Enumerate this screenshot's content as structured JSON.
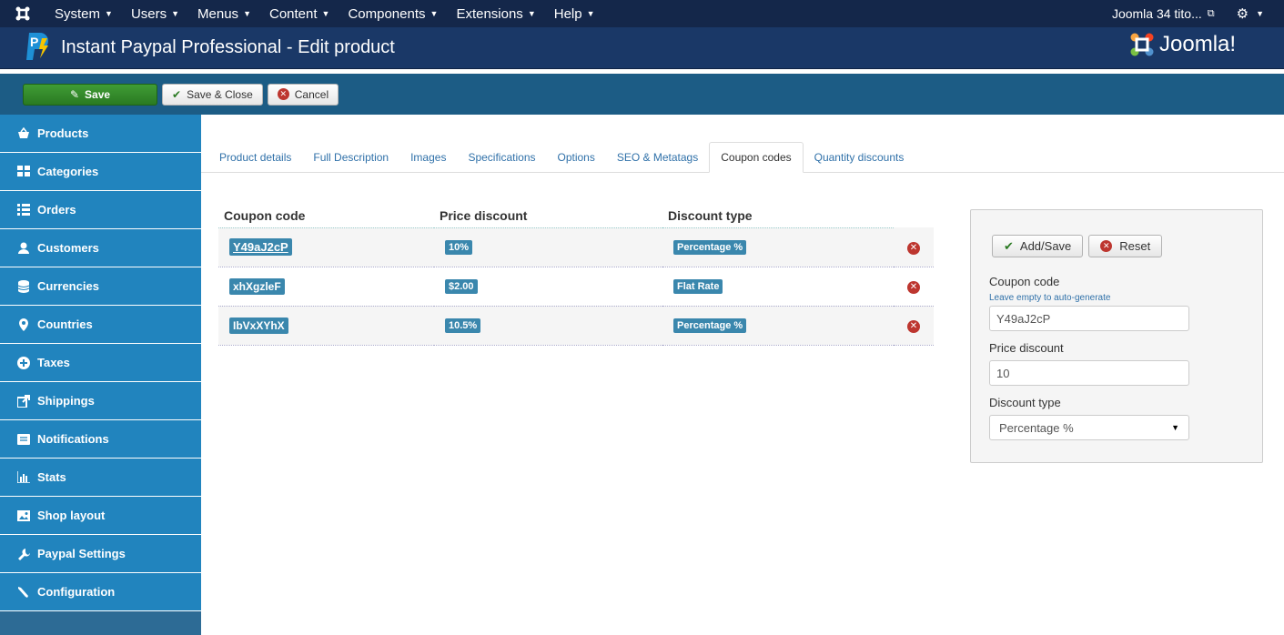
{
  "menubar": {
    "items": [
      "System",
      "Users",
      "Menus",
      "Content",
      "Components",
      "Extensions",
      "Help"
    ],
    "site_link": "Joomla 34 tito...",
    "icons": {
      "logo": "joomla-logo-icon",
      "external": "external-link-icon",
      "settings": "gear-icon"
    }
  },
  "header": {
    "title": "Instant Paypal Professional - Edit product",
    "brand": "Joomla!",
    "app_icon": "paypal-pro-icon"
  },
  "toolbar": {
    "save_label": "Save",
    "save_close_label": "Save & Close",
    "cancel_label": "Cancel"
  },
  "sidebar": {
    "items": [
      {
        "label": "Products",
        "icon": "basket-icon"
      },
      {
        "label": "Categories",
        "icon": "grid-icon"
      },
      {
        "label": "Orders",
        "icon": "list-icon"
      },
      {
        "label": "Customers",
        "icon": "user-icon"
      },
      {
        "label": "Currencies",
        "icon": "database-icon"
      },
      {
        "label": "Countries",
        "icon": "location-pin-icon"
      },
      {
        "label": "Taxes",
        "icon": "plus-circle-icon"
      },
      {
        "label": "Shippings",
        "icon": "share-icon"
      },
      {
        "label": "Notifications",
        "icon": "message-icon"
      },
      {
        "label": "Stats",
        "icon": "bar-chart-icon"
      },
      {
        "label": "Shop layout",
        "icon": "image-icon"
      },
      {
        "label": "Paypal Settings",
        "icon": "wrench-icon"
      },
      {
        "label": "Configuration",
        "icon": "tool-icon"
      }
    ]
  },
  "tabs": {
    "items": [
      "Product details",
      "Full Description",
      "Images",
      "Specifications",
      "Options",
      "SEO & Metatags",
      "Coupon codes",
      "Quantity discounts"
    ],
    "active": "Coupon codes"
  },
  "coupons": {
    "headers": [
      "Coupon code",
      "Price discount",
      "Discount type"
    ],
    "rows": [
      {
        "code": "Y49aJ2cP",
        "discount": "10%",
        "type": "Percentage %"
      },
      {
        "code": "xhXgzleF",
        "discount": "$2.00",
        "type": "Flat Rate"
      },
      {
        "code": "IbVxXYhX",
        "discount": "10.5%",
        "type": "Percentage %"
      }
    ]
  },
  "form": {
    "add_save_label": "Add/Save",
    "reset_label": "Reset",
    "coupon_code_label": "Coupon code",
    "coupon_code_hint": "Leave empty to auto-generate",
    "coupon_code_value": "Y49aJ2cP",
    "price_discount_label": "Price discount",
    "price_discount_value": "10",
    "discount_type_label": "Discount type",
    "discount_type_value": "Percentage %"
  },
  "colors": {
    "menubar": "#14274a",
    "header": "#1a3867",
    "toolbar": "#1c5c85",
    "sidebar_item": "#2184be",
    "save_button": "#3f9c35",
    "badge": "#3a87ad",
    "delete": "#bd362f"
  }
}
